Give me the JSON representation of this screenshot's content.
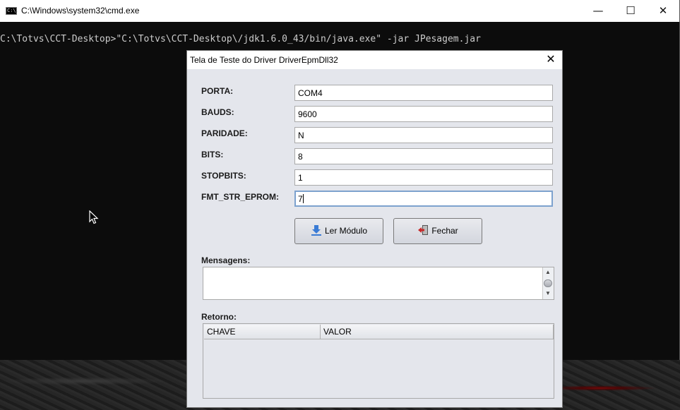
{
  "console": {
    "title": "C:\\Windows\\system32\\cmd.exe",
    "icon_text": "C:\\.",
    "controls": {
      "minimize": "—",
      "maximize": "☐",
      "close": "✕"
    },
    "command_line": "C:\\Totvs\\CCT-Desktop>\"C:\\Totvs\\CCT-Desktop\\/jdk1.6.0_43/bin/java.exe\" -jar JPesagem.jar"
  },
  "dialog": {
    "title": "Tela de Teste do Driver DriverEpmDll32",
    "close": "✕",
    "fields": [
      {
        "label": "PORTA:",
        "value": "COM4"
      },
      {
        "label": "BAUDS:",
        "value": "9600"
      },
      {
        "label": "PARIDADE:",
        "value": "N"
      },
      {
        "label": "BITS:",
        "value": "8"
      },
      {
        "label": "STOPBITS:",
        "value": "1"
      },
      {
        "label": "FMT_STR_EPROM:",
        "value": "7"
      }
    ],
    "buttons": {
      "read": "Ler Módulo",
      "close": "Fechar"
    },
    "messages_label": "Mensagens:",
    "messages_value": "",
    "return_label": "Retorno:",
    "table": {
      "columns": [
        "CHAVE",
        "VALOR"
      ],
      "rows": []
    }
  },
  "colors": {
    "console_bg": "#0c0c0c",
    "dialog_bg": "#e4e6ec",
    "focus_border": "#7da2ce"
  }
}
